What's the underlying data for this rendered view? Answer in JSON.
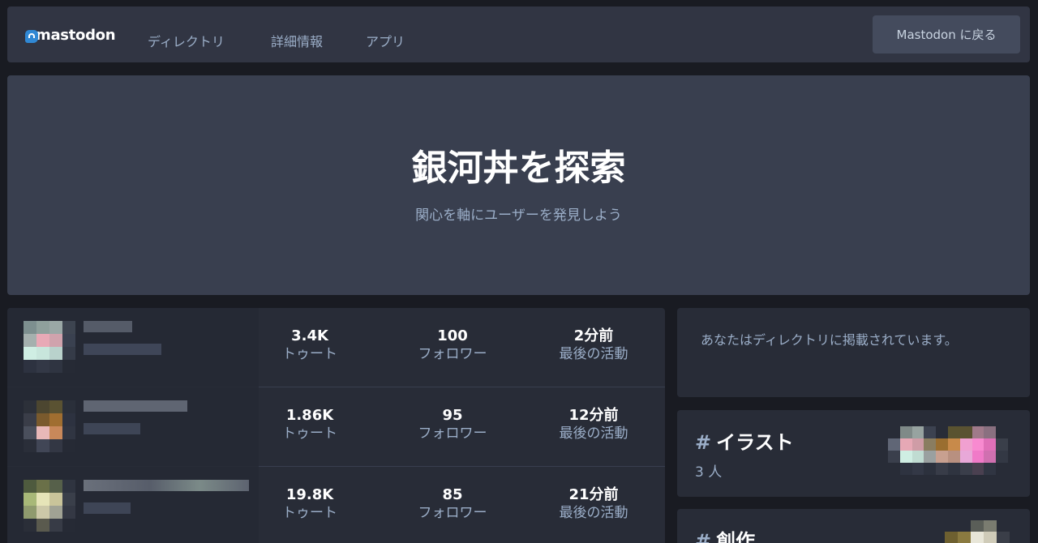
{
  "header": {
    "logo_text": "mastodon",
    "nav": [
      "ディレクトリ",
      "詳細情報",
      "アプリ"
    ],
    "back_button": "Mastodon に戻る"
  },
  "hero": {
    "title": "銀河丼を探索",
    "subtitle": "関心を軸にユーザーを発見しよう"
  },
  "directory": [
    {
      "toots": "3.4K",
      "toots_label": "トゥート",
      "followers": "100",
      "followers_label": "フォロワー",
      "last_active": "2分前",
      "last_active_label": "最後の活動"
    },
    {
      "toots": "1.86K",
      "toots_label": "トゥート",
      "followers": "95",
      "followers_label": "フォロワー",
      "last_active": "12分前",
      "last_active_label": "最後の活動"
    },
    {
      "toots": "19.8K",
      "toots_label": "トゥート",
      "followers": "85",
      "followers_label": "フォロワー",
      "last_active": "21分前",
      "last_active_label": "最後の活動"
    }
  ],
  "sidebar": {
    "notice": "あなたはディレクトリに掲載されています。",
    "tags": [
      {
        "hash": "#",
        "name": "イラスト",
        "count": "3 人"
      },
      {
        "hash": "#",
        "name": "創作",
        "count": ""
      }
    ]
  },
  "colors": {
    "background": "#191b22",
    "panel": "#282c37",
    "header": "#313543",
    "hero": "#393f4f",
    "muted_text": "#9baec8",
    "brand": "#3088d4"
  }
}
